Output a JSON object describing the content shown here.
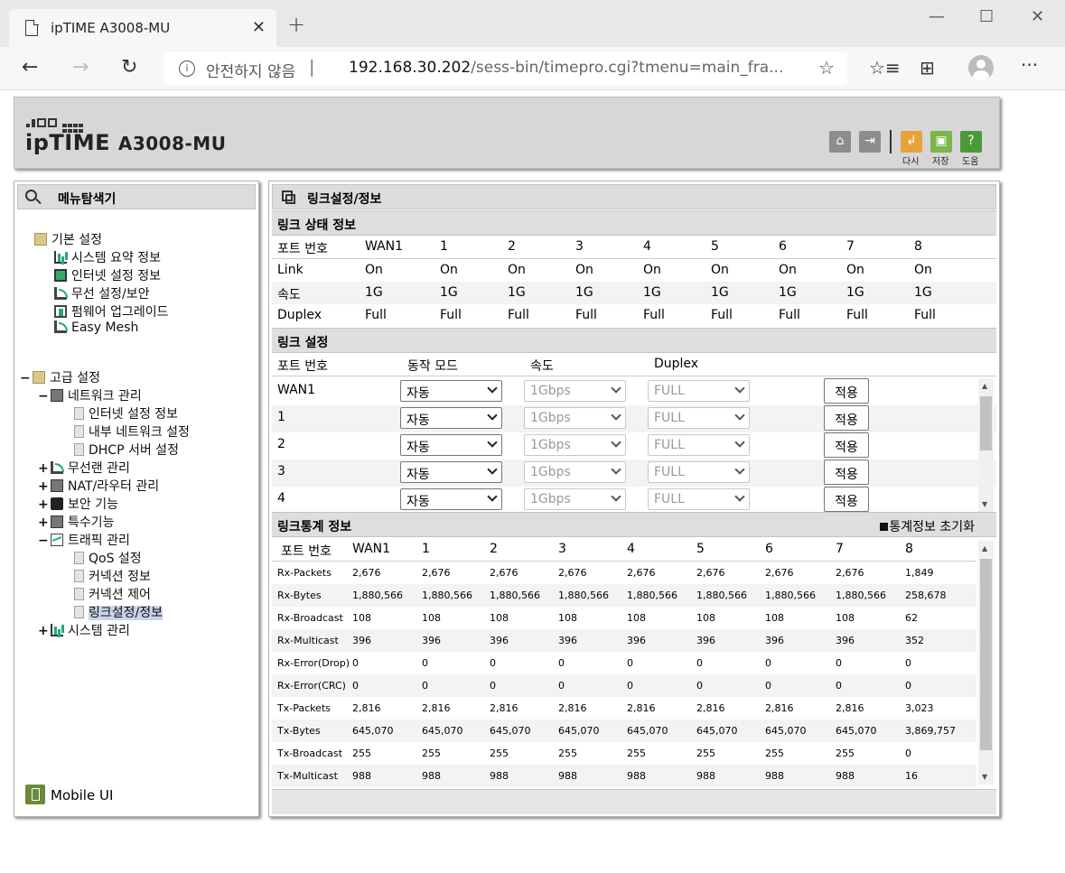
{
  "browser": {
    "tab_title": "ipTIME A3008-MU",
    "security_label": "안전하지 않음",
    "url_host": "192.168.30.202",
    "url_path": "/sess-bin/timepro.cgi?tmenu=main_fra..."
  },
  "header": {
    "brand": "ipTIME",
    "model": "A3008-MU",
    "buttons": [
      {
        "label": "다시",
        "icon": "refresh-icon",
        "color": "#e8a23c"
      },
      {
        "label": "저장",
        "icon": "save-icon",
        "color": "#7ab648"
      },
      {
        "label": "도움",
        "icon": "help-icon",
        "color": "#4a9a3a"
      }
    ]
  },
  "sidebar": {
    "title": "메뉴탐색기",
    "basic": {
      "label": "기본 설정",
      "items": [
        "시스템 요약 정보",
        "인터넷 설정 정보",
        "무선 설정/보안",
        "펌웨어 업그레이드",
        "Easy Mesh"
      ]
    },
    "advanced": {
      "label": "고급 설정",
      "network": {
        "label": "네트워크 관리",
        "items": [
          "인터넷 설정 정보",
          "내부 네트워크 설정",
          "DHCP 서버 설정"
        ]
      },
      "wireless": "무선랜 관리",
      "nat": "NAT/라우터 관리",
      "security": "보안 기능",
      "special": "특수기능",
      "traffic": {
        "label": "트래픽 관리",
        "items": [
          "QoS 설정",
          "커넥션 정보",
          "커넥션 제어",
          "링크설정/정보"
        ]
      },
      "system": "시스템 관리"
    },
    "mobile_ui": "Mobile UI"
  },
  "main": {
    "title": "링크설정/정보",
    "link_status": {
      "title": "링크 상태 정보",
      "header": [
        "포트 번호",
        "WAN1",
        "1",
        "2",
        "3",
        "4",
        "5",
        "6",
        "7",
        "8"
      ],
      "rows": [
        [
          "Link",
          "On",
          "On",
          "On",
          "On",
          "On",
          "On",
          "On",
          "On",
          "On"
        ],
        [
          "속도",
          "1G",
          "1G",
          "1G",
          "1G",
          "1G",
          "1G",
          "1G",
          "1G",
          "1G"
        ],
        [
          "Duplex",
          "Full",
          "Full",
          "Full",
          "Full",
          "Full",
          "Full",
          "Full",
          "Full",
          "Full"
        ]
      ]
    },
    "link_setup": {
      "title": "링크 설정",
      "header": [
        "포트 번호",
        "동작 모드",
        "속도",
        "Duplex"
      ],
      "apply_label": "적용",
      "rows": [
        {
          "port": "WAN1",
          "mode": "자동",
          "speed": "1Gbps",
          "duplex": "FULL"
        },
        {
          "port": "1",
          "mode": "자동",
          "speed": "1Gbps",
          "duplex": "FULL"
        },
        {
          "port": "2",
          "mode": "자동",
          "speed": "1Gbps",
          "duplex": "FULL"
        },
        {
          "port": "3",
          "mode": "자동",
          "speed": "1Gbps",
          "duplex": "FULL"
        },
        {
          "port": "4",
          "mode": "자동",
          "speed": "1Gbps",
          "duplex": "FULL"
        }
      ]
    },
    "link_stats": {
      "title": "링크통계 정보",
      "reset_label": "통계정보 초기화",
      "header": [
        "포트 번호",
        "WAN1",
        "1",
        "2",
        "3",
        "4",
        "5",
        "6",
        "7",
        "8"
      ],
      "rows": [
        [
          "Rx-Packets",
          "2,676",
          "2,676",
          "2,676",
          "2,676",
          "2,676",
          "2,676",
          "2,676",
          "2,676",
          "1,849"
        ],
        [
          "Rx-Bytes",
          "1,880,566",
          "1,880,566",
          "1,880,566",
          "1,880,566",
          "1,880,566",
          "1,880,566",
          "1,880,566",
          "1,880,566",
          "258,678"
        ],
        [
          "Rx-Broadcast",
          "108",
          "108",
          "108",
          "108",
          "108",
          "108",
          "108",
          "108",
          "62"
        ],
        [
          "Rx-Multicast",
          "396",
          "396",
          "396",
          "396",
          "396",
          "396",
          "396",
          "396",
          "352"
        ],
        [
          "Rx-Error(Drop)",
          "0",
          "0",
          "0",
          "0",
          "0",
          "0",
          "0",
          "0",
          "0"
        ],
        [
          "Rx-Error(CRC)",
          "0",
          "0",
          "0",
          "0",
          "0",
          "0",
          "0",
          "0",
          "0"
        ],
        [
          "Tx-Packets",
          "2,816",
          "2,816",
          "2,816",
          "2,816",
          "2,816",
          "2,816",
          "2,816",
          "2,816",
          "3,023"
        ],
        [
          "Tx-Bytes",
          "645,070",
          "645,070",
          "645,070",
          "645,070",
          "645,070",
          "645,070",
          "645,070",
          "645,070",
          "3,869,757"
        ],
        [
          "Tx-Broadcast",
          "255",
          "255",
          "255",
          "255",
          "255",
          "255",
          "255",
          "255",
          "0"
        ],
        [
          "Tx-Multicast",
          "988",
          "988",
          "988",
          "988",
          "988",
          "988",
          "988",
          "988",
          "16"
        ]
      ]
    }
  }
}
